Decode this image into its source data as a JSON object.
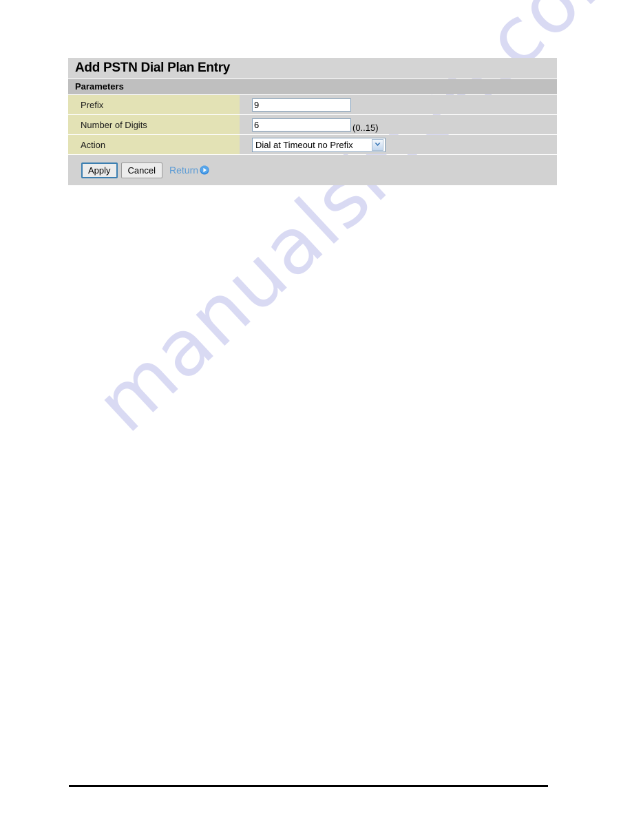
{
  "panel": {
    "title": "Add PSTN Dial Plan Entry",
    "section_header": "Parameters",
    "rows": [
      {
        "label": "Prefix",
        "type": "text",
        "value": "9",
        "placeholder": "",
        "hint": ""
      },
      {
        "label": "Number of Digits",
        "type": "text",
        "value": "6",
        "placeholder": "",
        "hint": "(0..15)"
      },
      {
        "label": "Action",
        "type": "select",
        "value": "Dial at Timeout no Prefix",
        "options": [
          "Dial at Timeout no Prefix"
        ],
        "hint": ""
      }
    ],
    "buttons": {
      "apply_label": "Apply",
      "cancel_label": "Cancel",
      "return_label": "Return",
      "return_icon": "play-circle-icon"
    }
  },
  "watermark": {
    "text": "manualshive.com",
    "color": "#d9daf3"
  },
  "colors": {
    "title_bar": "#d4d4d4",
    "section_header": "#bfbfbf",
    "row_background": "#d2d2d2",
    "label_background": "#e3e2b5",
    "input_border": "#7f9db9",
    "link": "#5b9bd5",
    "focus_border": "#3c7fb1"
  }
}
